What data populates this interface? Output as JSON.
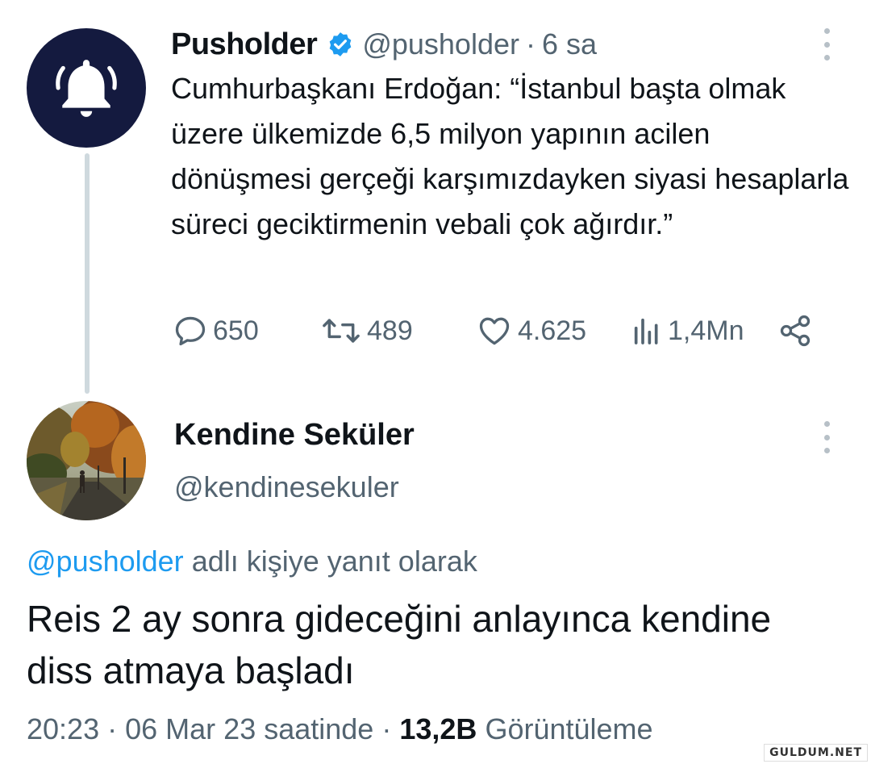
{
  "tweet": {
    "display_name": "Pusholder",
    "handle": "@pusholder",
    "separator": "·",
    "time": "6 sa",
    "text": "Cumhurbaşkanı Erdoğan: “İstanbul başta olmak üzere ülkemizde 6,5 milyon yapının acilen dönüşmesi gerçeği karşımızdayken siyasi hesaplarla süreci geciktirmenin vebali çok ağırdır.”",
    "stats": {
      "replies": "650",
      "retweets": "489",
      "likes": "4.625",
      "views": "1,4Mn"
    }
  },
  "reply": {
    "display_name": "Kendine Seküler",
    "handle": "@kendinesekuler",
    "reply_context_mention": "@pusholder",
    "reply_context_text": "adlı kişiye yanıt olarak",
    "text": "Reis 2 ay sonra gideceğini anlayınca kendine diss atmaya başladı",
    "meta": {
      "time": "20:23",
      "separator": "·",
      "date": "06 Mar 23 saatinde",
      "views_count": "13,2B",
      "views_label": "Görüntüleme"
    }
  },
  "watermark": "GULDUM.NET",
  "icons": {
    "avatar1": "bell-icon",
    "verified": "verified-badge-icon",
    "more": "more-vertical-icon",
    "reply": "reply-icon",
    "retweet": "retweet-icon",
    "like": "heart-icon",
    "views": "views-icon",
    "share": "share-icon"
  },
  "colors": {
    "brand_blue": "#1d9bf0",
    "secondary_text": "#536471",
    "avatar1_bg": "#141a3f"
  }
}
